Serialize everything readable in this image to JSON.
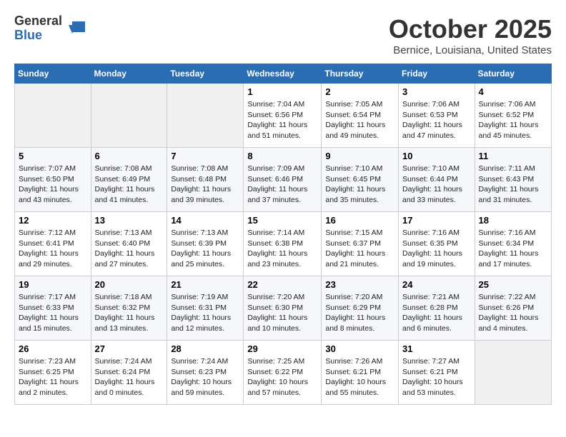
{
  "logo": {
    "general": "General",
    "blue": "Blue"
  },
  "title": "October 2025",
  "location": "Bernice, Louisiana, United States",
  "weekdays": [
    "Sunday",
    "Monday",
    "Tuesday",
    "Wednesday",
    "Thursday",
    "Friday",
    "Saturday"
  ],
  "weeks": [
    [
      {
        "day": "",
        "content": ""
      },
      {
        "day": "",
        "content": ""
      },
      {
        "day": "",
        "content": ""
      },
      {
        "day": "1",
        "content": "Sunrise: 7:04 AM\nSunset: 6:56 PM\nDaylight: 11 hours\nand 51 minutes."
      },
      {
        "day": "2",
        "content": "Sunrise: 7:05 AM\nSunset: 6:54 PM\nDaylight: 11 hours\nand 49 minutes."
      },
      {
        "day": "3",
        "content": "Sunrise: 7:06 AM\nSunset: 6:53 PM\nDaylight: 11 hours\nand 47 minutes."
      },
      {
        "day": "4",
        "content": "Sunrise: 7:06 AM\nSunset: 6:52 PM\nDaylight: 11 hours\nand 45 minutes."
      }
    ],
    [
      {
        "day": "5",
        "content": "Sunrise: 7:07 AM\nSunset: 6:50 PM\nDaylight: 11 hours\nand 43 minutes."
      },
      {
        "day": "6",
        "content": "Sunrise: 7:08 AM\nSunset: 6:49 PM\nDaylight: 11 hours\nand 41 minutes."
      },
      {
        "day": "7",
        "content": "Sunrise: 7:08 AM\nSunset: 6:48 PM\nDaylight: 11 hours\nand 39 minutes."
      },
      {
        "day": "8",
        "content": "Sunrise: 7:09 AM\nSunset: 6:46 PM\nDaylight: 11 hours\nand 37 minutes."
      },
      {
        "day": "9",
        "content": "Sunrise: 7:10 AM\nSunset: 6:45 PM\nDaylight: 11 hours\nand 35 minutes."
      },
      {
        "day": "10",
        "content": "Sunrise: 7:10 AM\nSunset: 6:44 PM\nDaylight: 11 hours\nand 33 minutes."
      },
      {
        "day": "11",
        "content": "Sunrise: 7:11 AM\nSunset: 6:43 PM\nDaylight: 11 hours\nand 31 minutes."
      }
    ],
    [
      {
        "day": "12",
        "content": "Sunrise: 7:12 AM\nSunset: 6:41 PM\nDaylight: 11 hours\nand 29 minutes."
      },
      {
        "day": "13",
        "content": "Sunrise: 7:13 AM\nSunset: 6:40 PM\nDaylight: 11 hours\nand 27 minutes."
      },
      {
        "day": "14",
        "content": "Sunrise: 7:13 AM\nSunset: 6:39 PM\nDaylight: 11 hours\nand 25 minutes."
      },
      {
        "day": "15",
        "content": "Sunrise: 7:14 AM\nSunset: 6:38 PM\nDaylight: 11 hours\nand 23 minutes."
      },
      {
        "day": "16",
        "content": "Sunrise: 7:15 AM\nSunset: 6:37 PM\nDaylight: 11 hours\nand 21 minutes."
      },
      {
        "day": "17",
        "content": "Sunrise: 7:16 AM\nSunset: 6:35 PM\nDaylight: 11 hours\nand 19 minutes."
      },
      {
        "day": "18",
        "content": "Sunrise: 7:16 AM\nSunset: 6:34 PM\nDaylight: 11 hours\nand 17 minutes."
      }
    ],
    [
      {
        "day": "19",
        "content": "Sunrise: 7:17 AM\nSunset: 6:33 PM\nDaylight: 11 hours\nand 15 minutes."
      },
      {
        "day": "20",
        "content": "Sunrise: 7:18 AM\nSunset: 6:32 PM\nDaylight: 11 hours\nand 13 minutes."
      },
      {
        "day": "21",
        "content": "Sunrise: 7:19 AM\nSunset: 6:31 PM\nDaylight: 11 hours\nand 12 minutes."
      },
      {
        "day": "22",
        "content": "Sunrise: 7:20 AM\nSunset: 6:30 PM\nDaylight: 11 hours\nand 10 minutes."
      },
      {
        "day": "23",
        "content": "Sunrise: 7:20 AM\nSunset: 6:29 PM\nDaylight: 11 hours\nand 8 minutes."
      },
      {
        "day": "24",
        "content": "Sunrise: 7:21 AM\nSunset: 6:28 PM\nDaylight: 11 hours\nand 6 minutes."
      },
      {
        "day": "25",
        "content": "Sunrise: 7:22 AM\nSunset: 6:26 PM\nDaylight: 11 hours\nand 4 minutes."
      }
    ],
    [
      {
        "day": "26",
        "content": "Sunrise: 7:23 AM\nSunset: 6:25 PM\nDaylight: 11 hours\nand 2 minutes."
      },
      {
        "day": "27",
        "content": "Sunrise: 7:24 AM\nSunset: 6:24 PM\nDaylight: 11 hours\nand 0 minutes."
      },
      {
        "day": "28",
        "content": "Sunrise: 7:24 AM\nSunset: 6:23 PM\nDaylight: 10 hours\nand 59 minutes."
      },
      {
        "day": "29",
        "content": "Sunrise: 7:25 AM\nSunset: 6:22 PM\nDaylight: 10 hours\nand 57 minutes."
      },
      {
        "day": "30",
        "content": "Sunrise: 7:26 AM\nSunset: 6:21 PM\nDaylight: 10 hours\nand 55 minutes."
      },
      {
        "day": "31",
        "content": "Sunrise: 7:27 AM\nSunset: 6:21 PM\nDaylight: 10 hours\nand 53 minutes."
      },
      {
        "day": "",
        "content": ""
      }
    ]
  ]
}
